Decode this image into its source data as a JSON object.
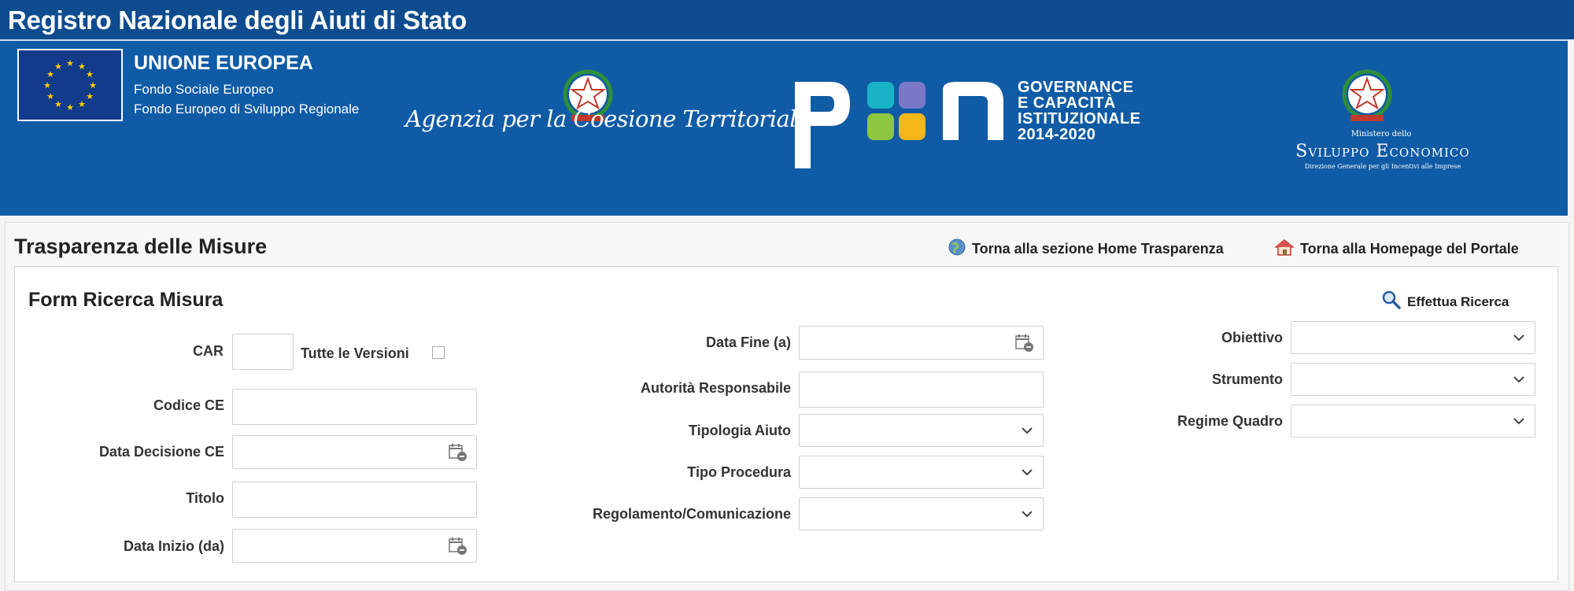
{
  "header": {
    "title": "Registro Nazionale degli Aiuti di Stato"
  },
  "banner": {
    "eu_title": "UNIONE EUROPEA",
    "eu_line1": "Fondo Sociale Europeo",
    "eu_line2": "Fondo Europeo di Sviluppo Regionale",
    "agenzia": "Agenzia per la Coesione Territoriale",
    "pon_line1": "GOVERNANCE",
    "pon_line2": "E CAPACITÀ",
    "pon_line3": "ISTITUZIONALE",
    "pon_line4": "2014-2020",
    "mise_ministero": "Ministero dello",
    "mise_sviluppo": "Sviluppo Economico",
    "mise_direzione": "Direzione Generale per gli Incentivi alle Imprese",
    "colors": {
      "banner_blue": "#0f5ba6",
      "title_blue": "#0e4c8f"
    }
  },
  "page": {
    "section_title": "Trasparenza delle Misure",
    "link_home_trasparenza": "Torna alla sezione Home Trasparenza",
    "link_homepage_portale": "Torna alla Homepage del Portale"
  },
  "form": {
    "title": "Form Ricerca Misura",
    "search_button": "Effettua Ricerca",
    "car_label": "CAR",
    "car_value": "",
    "tutte_versioni_label": "Tutte le Versioni",
    "tutte_versioni_checked": false,
    "codice_ce_label": "Codice CE",
    "codice_ce_value": "",
    "data_decisione_label": "Data Decisione CE",
    "data_decisione_value": "",
    "titolo_label": "Titolo",
    "titolo_value": "",
    "data_inizio_label": "Data Inizio (da)",
    "data_inizio_value": "",
    "data_fine_label": "Data Fine (a)",
    "data_fine_value": "",
    "autorita_label": "Autorità Responsabile",
    "autorita_value": "",
    "tipologia_label": "Tipologia Aiuto",
    "tipologia_value": "",
    "tipo_procedura_label": "Tipo Procedura",
    "tipo_procedura_value": "",
    "regolamento_label": "Regolamento/Comunicazione",
    "regolamento_value": "",
    "obiettivo_label": "Obiettivo",
    "obiettivo_value": "",
    "strumento_label": "Strumento",
    "strumento_value": "",
    "regime_label": "Regime Quadro",
    "regime_value": ""
  }
}
